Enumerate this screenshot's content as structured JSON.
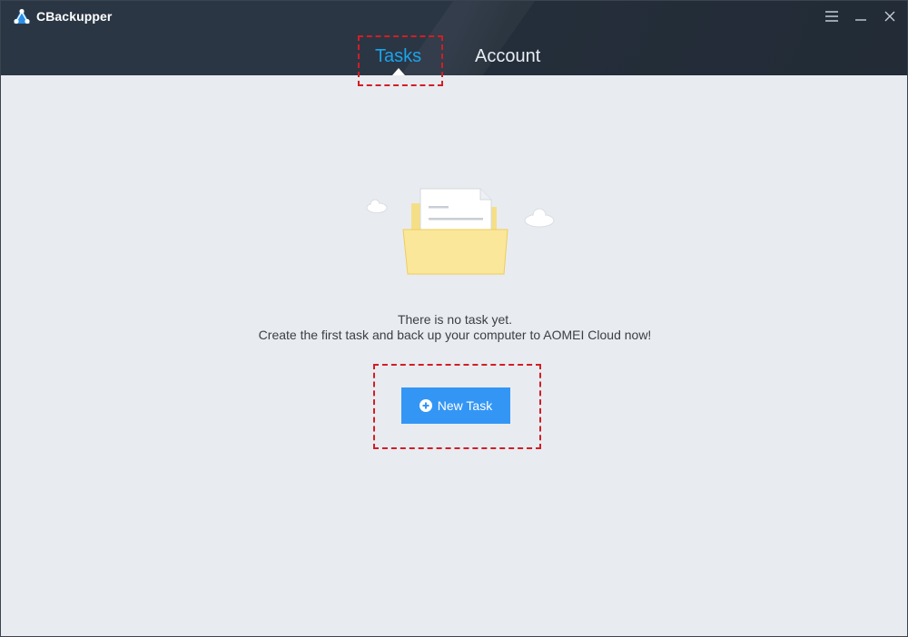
{
  "app": {
    "title": "CBackupper",
    "logo_icon": "cbackupper-logo-icon"
  },
  "window_controls": {
    "menu_icon": "hamburger-menu-icon",
    "minimize_icon": "minimize-icon",
    "close_icon": "close-icon"
  },
  "tabs": [
    {
      "label": "Tasks",
      "active": true
    },
    {
      "label": "Account",
      "active": false
    }
  ],
  "empty_state": {
    "illustration_icon": "folder-document-icon",
    "line1": "There is no task yet.",
    "line2": "Create the first task and back up your computer to AOMEI Cloud now!"
  },
  "new_task": {
    "label": "New Task",
    "icon": "plus-circle-icon"
  },
  "colors": {
    "titlebar": "#2b3644",
    "active_tab": "#1aa3ec",
    "content_bg": "#e8ecf1",
    "button": "#3396f5",
    "highlight": "#d21e24"
  }
}
